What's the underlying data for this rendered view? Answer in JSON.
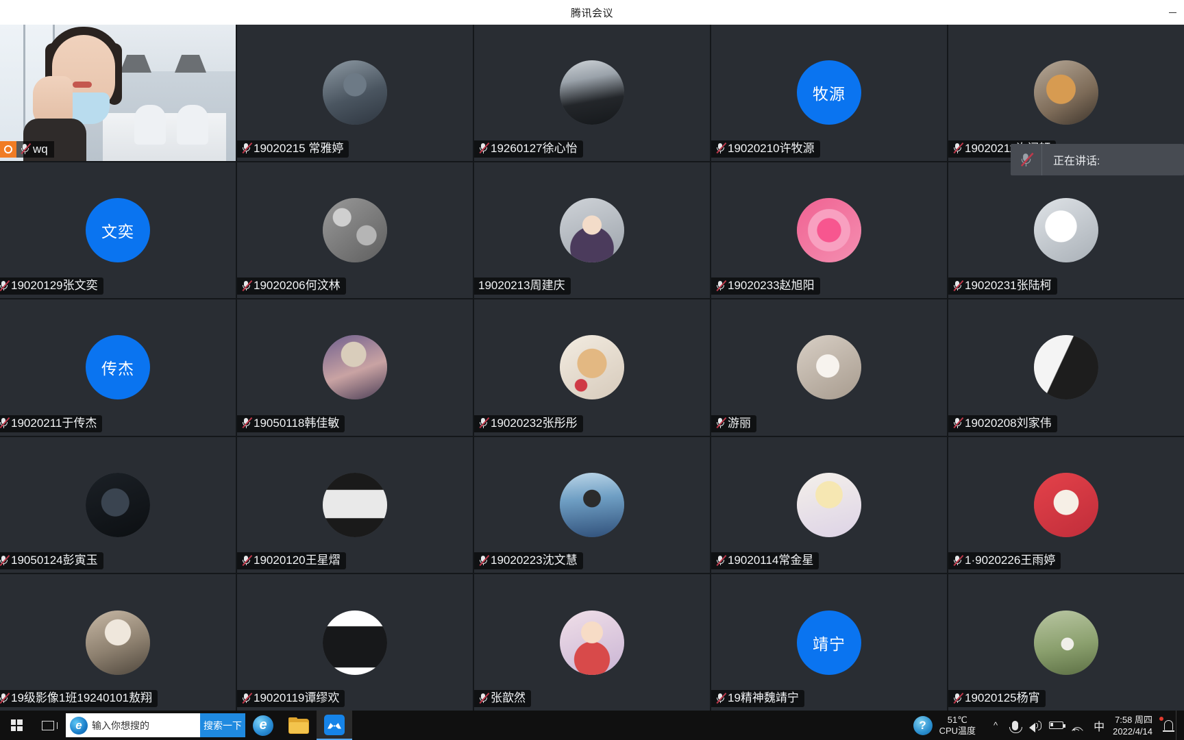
{
  "window": {
    "title": "腾讯会议",
    "controls": [
      {
        "name": "minimize",
        "glyph": "—"
      }
    ]
  },
  "speaking_overlay": {
    "mic_icon": "mic-muted-icon",
    "label": "正在讲话:",
    "collapse_icon": "double-chevron-icon"
  },
  "grid": {
    "columns": 5,
    "rows": 5,
    "tiles": [
      {
        "name": "wq",
        "kind": "video",
        "muted": true,
        "badge": true,
        "display": "wq"
      },
      {
        "name": "19020215 常雅婷",
        "kind": "photo",
        "muted": true,
        "photo": "hanfu-person"
      },
      {
        "name": "19260127徐心怡",
        "kind": "photo",
        "muted": true,
        "photo": "dark-room"
      },
      {
        "name": "19020210许牧源",
        "kind": "initials",
        "muted": true,
        "initials": "牧源"
      },
      {
        "name": "19020211许闻轩",
        "kind": "photo",
        "muted": true,
        "photo": "shiba-desk"
      },
      {
        "name": "19020129张文奕",
        "kind": "initials",
        "muted": true,
        "initials": "文奕"
      },
      {
        "name": "19020206何汶林",
        "kind": "photo",
        "muted": true,
        "photo": "gray-stones"
      },
      {
        "name": "19020213周建庆",
        "kind": "photo",
        "muted": false,
        "photo": "anime-boy"
      },
      {
        "name": "19020233赵旭阳",
        "kind": "photo",
        "muted": true,
        "photo": "pink-flower"
      },
      {
        "name": "19020231张陆柯",
        "kind": "photo",
        "muted": true,
        "photo": "husky-meme"
      },
      {
        "name": "19020211于传杰",
        "kind": "initials",
        "muted": true,
        "initials": "传杰"
      },
      {
        "name": "19050118韩佳敏",
        "kind": "photo",
        "muted": true,
        "photo": "cap-person"
      },
      {
        "name": "19020232张彤彤",
        "kind": "photo",
        "muted": true,
        "photo": "pomeranian"
      },
      {
        "name": "游丽",
        "kind": "photo",
        "muted": true,
        "photo": "white-cat"
      },
      {
        "name": "19020208刘家伟",
        "kind": "photo",
        "muted": true,
        "photo": "manga-bw"
      },
      {
        "name": "19050124彭寅玉",
        "kind": "photo",
        "muted": true,
        "photo": "dark-portrait"
      },
      {
        "name": "19020120王星熠",
        "kind": "photo",
        "muted": true,
        "photo": "text-poster"
      },
      {
        "name": "19020223沈文慧",
        "kind": "photo",
        "muted": true,
        "photo": "beach-person"
      },
      {
        "name": "19020114常金星",
        "kind": "photo",
        "muted": true,
        "photo": "anime-angel"
      },
      {
        "name": "1·9020226王雨婷",
        "kind": "photo",
        "muted": true,
        "photo": "red-cartoon"
      },
      {
        "name": "19级影像1班19240101敖翔",
        "kind": "photo",
        "muted": true,
        "photo": "white-hair-anime"
      },
      {
        "name": "19020119谭缪欢",
        "kind": "photo",
        "muted": true,
        "photo": "black-cup"
      },
      {
        "name": "张歆然",
        "kind": "photo",
        "muted": true,
        "photo": "sakura-anime"
      },
      {
        "name": "19精神魏靖宁",
        "kind": "initials",
        "muted": true,
        "initials": "靖宁"
      },
      {
        "name": "19020125杨宵",
        "kind": "photo",
        "muted": true,
        "photo": "field-girl"
      }
    ]
  },
  "taskbar": {
    "start_icon": "windows-start-icon",
    "taskview_icon": "task-view-icon",
    "search": {
      "icon": "ie-icon",
      "placeholder": "输入你想搜的",
      "value": "",
      "button_label": "搜索一下"
    },
    "pinned": [
      {
        "name": "internet-explorer",
        "icon": "ie-icon"
      },
      {
        "name": "file-explorer",
        "icon": "folder-icon"
      },
      {
        "name": "tencent-meeting",
        "icon": "tencent-meeting-icon",
        "active": true
      }
    ],
    "tray": {
      "help_icon": "help-question-icon",
      "cpu_temp_value": "51℃",
      "cpu_temp_label": "CPU温度",
      "overflow_icon": "chevron-up-icon",
      "mic_icon": "microphone-icon",
      "volume_icon": "speaker-icon",
      "battery_icon": "battery-icon",
      "network_icon": "wifi-icon",
      "ime_label": "中",
      "clock_time": "7:58 周四",
      "clock_date": "2022/4/14",
      "notification_icon": "notification-bell-icon"
    }
  },
  "colors": {
    "accent_blue": "#0a74f0",
    "tile_bg": "#292d33",
    "taskbar_bg": "#101010",
    "search_button": "#1f8ae0"
  }
}
